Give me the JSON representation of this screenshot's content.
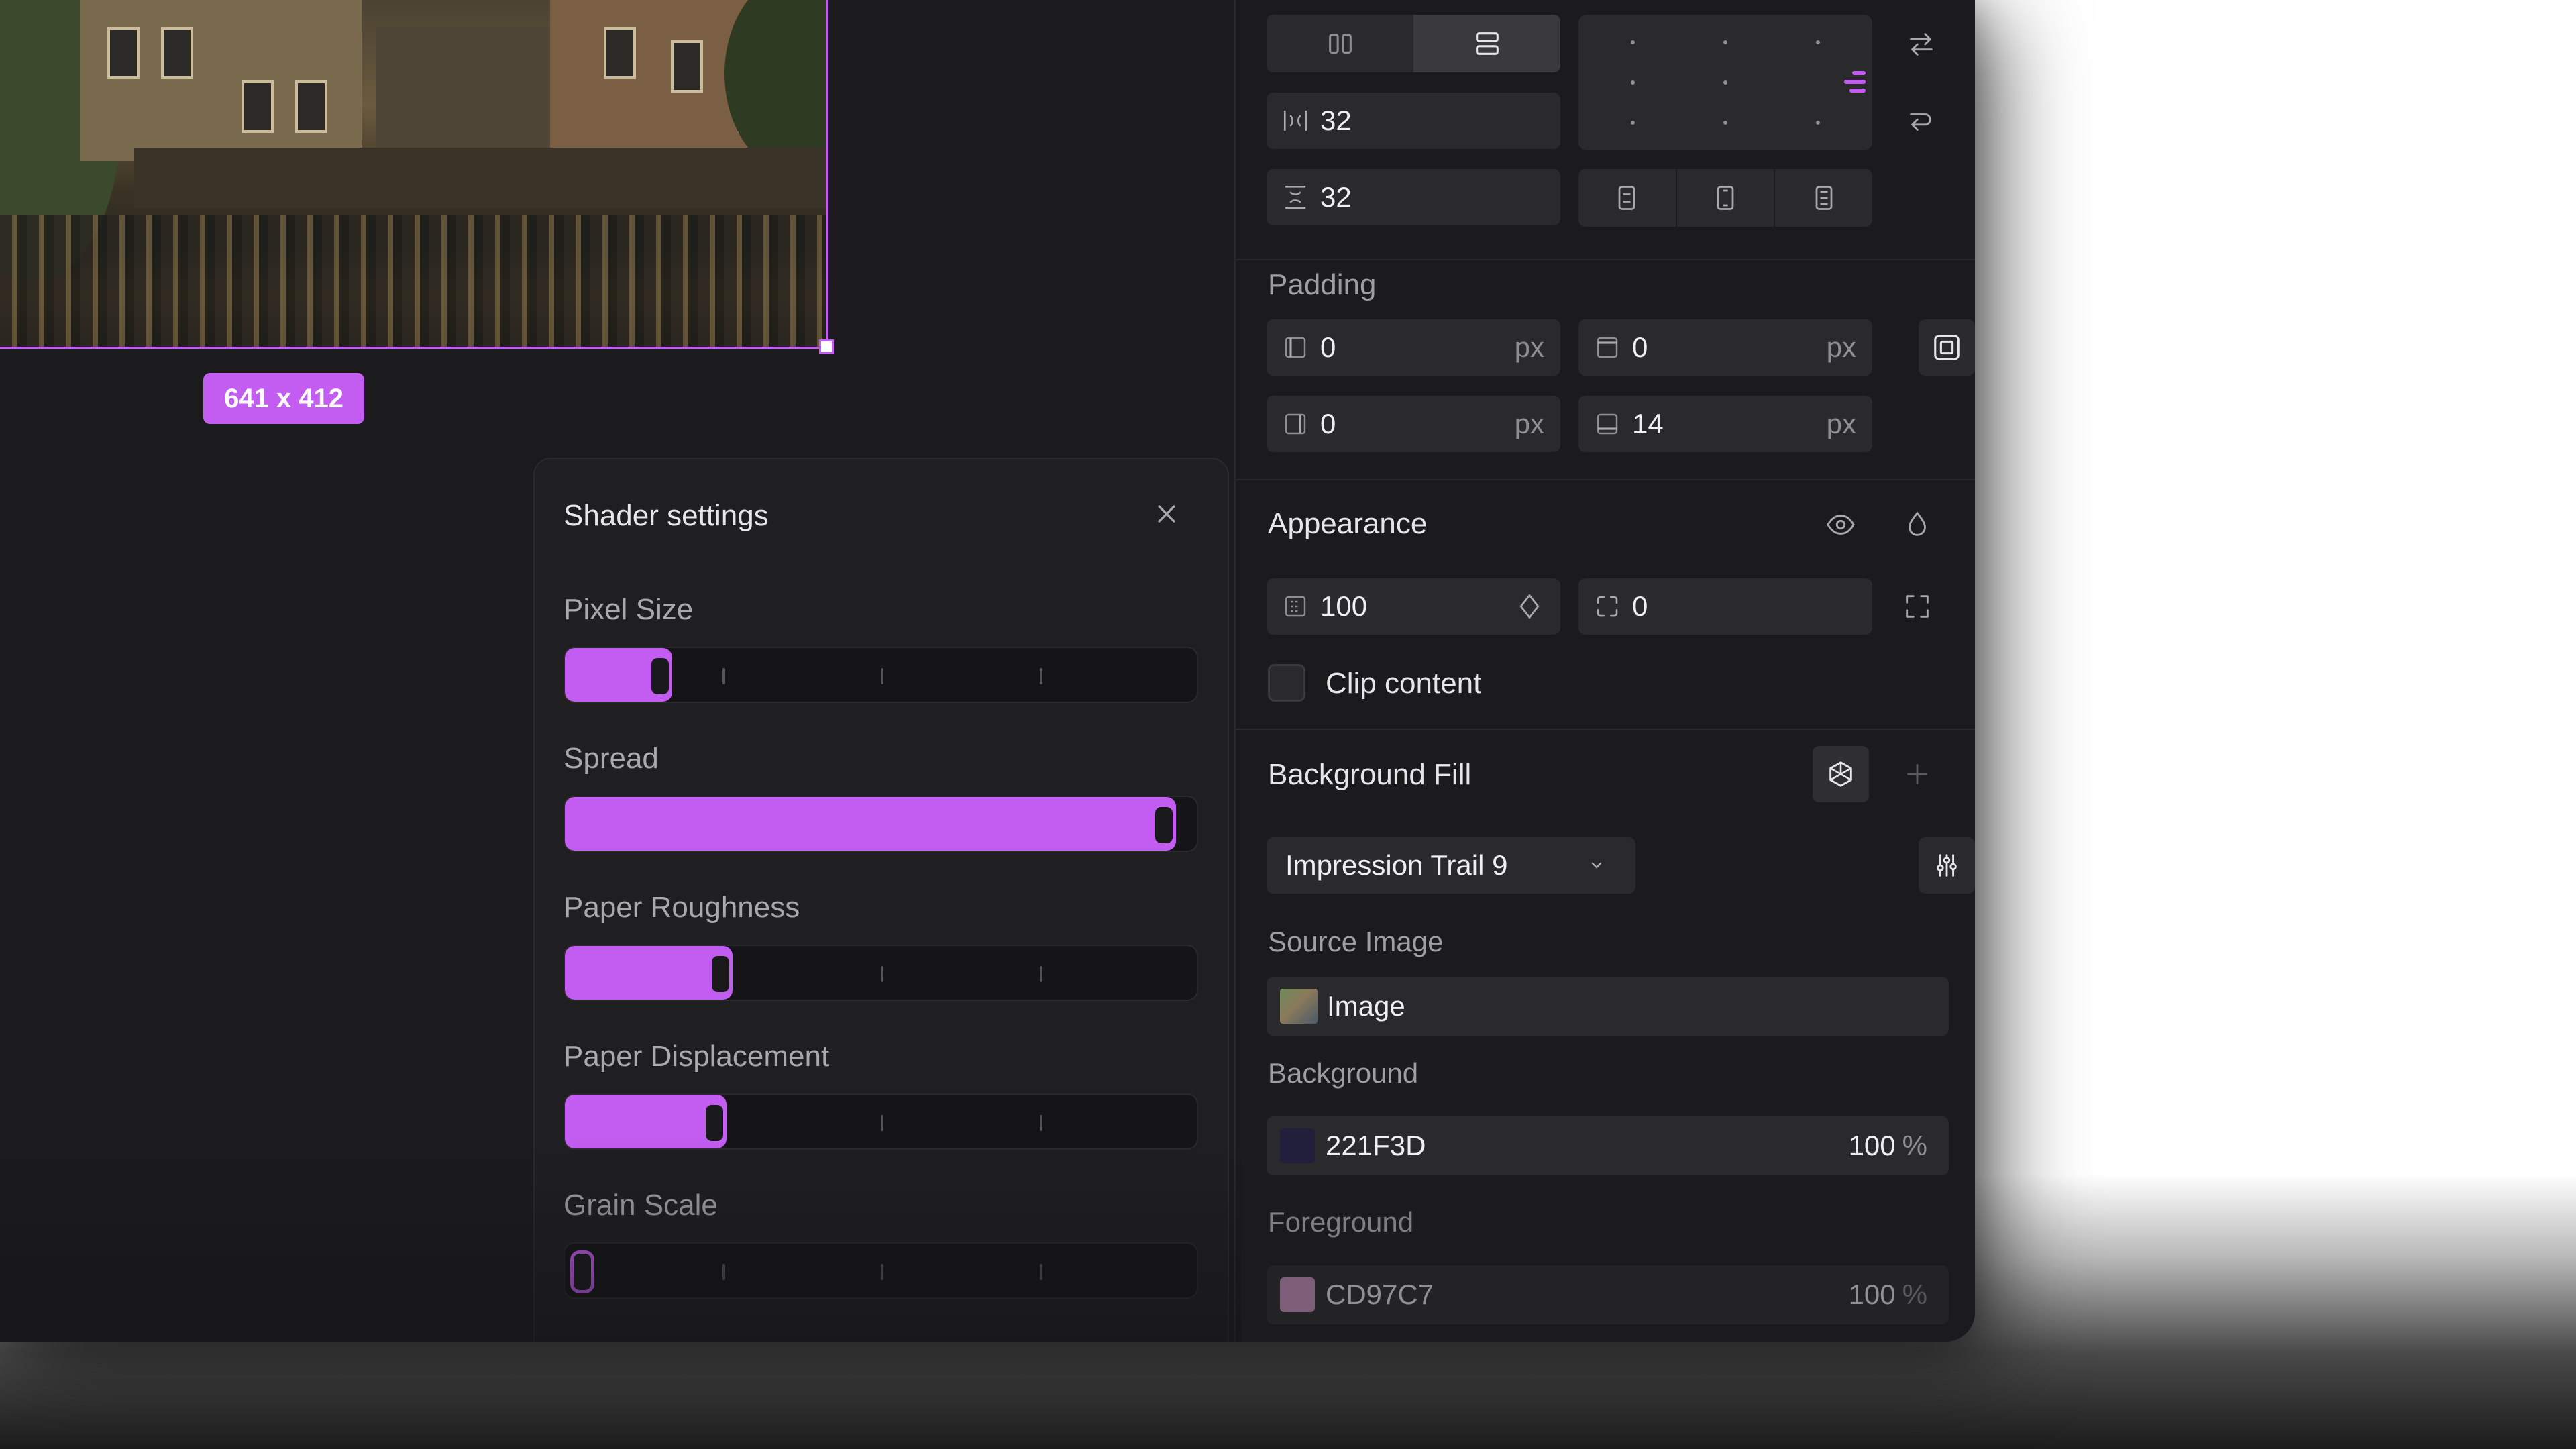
{
  "canvas": {
    "size_badge": "641 x 412"
  },
  "shader_panel": {
    "title": "Shader settings",
    "sliders": [
      {
        "label": "Pixel Size",
        "value": 0.13
      },
      {
        "label": "Spread",
        "value": 0.97
      },
      {
        "label": "Paper Roughness",
        "value": 0.23
      },
      {
        "label": "Paper Displacement",
        "value": 0.22
      },
      {
        "label": "Grain Scale",
        "value": 0.0
      }
    ]
  },
  "layout_section": {
    "gap_horizontal": "32",
    "gap_vertical": "32"
  },
  "padding": {
    "title": "Padding",
    "left": "0",
    "top": "0",
    "right": "0",
    "bottom": "14",
    "unit": "px"
  },
  "appearance": {
    "title": "Appearance",
    "opacity": "100",
    "radius": "0",
    "clip_label": "Clip content"
  },
  "background_fill": {
    "title": "Background Fill",
    "preset": "Impression Trail 9",
    "source_image_label": "Source Image",
    "source_image_value": "Image",
    "background_label": "Background",
    "background_hex": "221F3D",
    "background_color": "#221F3D",
    "background_opacity": "100",
    "foreground_label": "Foreground",
    "foreground_hex": "CD97C7",
    "foreground_color": "#CD97C7",
    "foreground_opacity": "100",
    "percent": "%"
  },
  "colors": {
    "accent": "#C35CF0"
  }
}
